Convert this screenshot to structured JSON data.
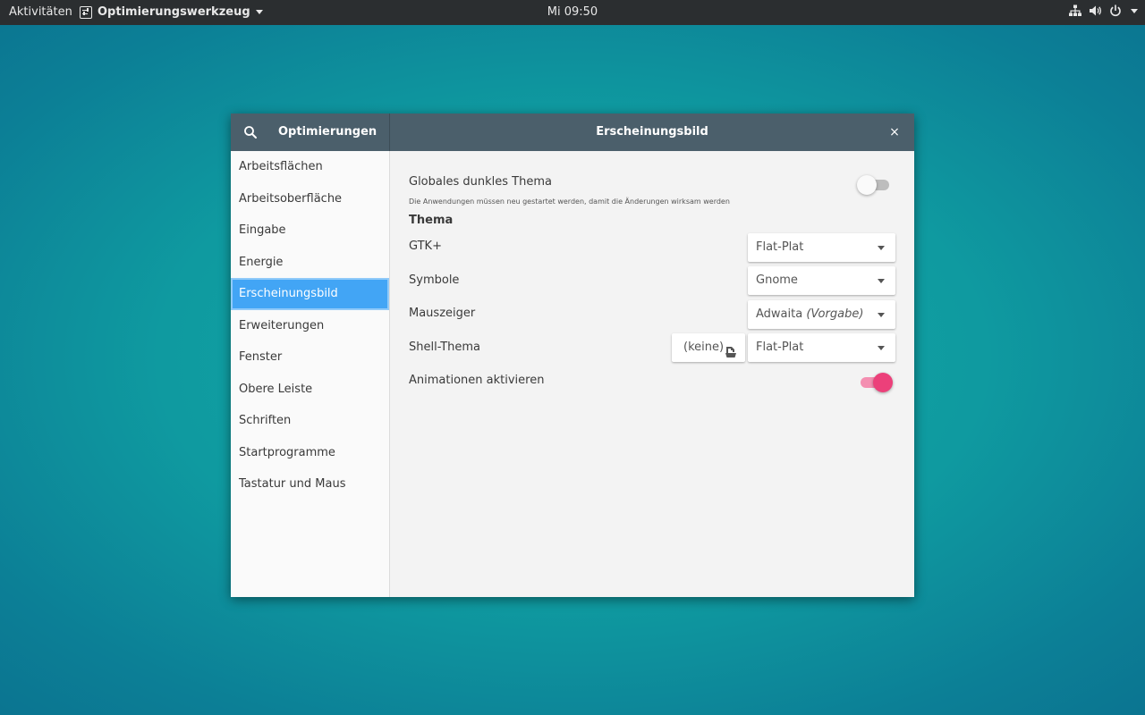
{
  "topbar": {
    "activities": "Aktivitäten",
    "app_name": "Optimierungswerkzeug",
    "clock": "Mi 09:50"
  },
  "window": {
    "sidebar_title": "Optimierungen",
    "title": "Erscheinungsbild",
    "close": "×"
  },
  "sidebar": {
    "items": [
      {
        "label": "Arbeitsflächen"
      },
      {
        "label": "Arbeitsoberfläche"
      },
      {
        "label": "Eingabe"
      },
      {
        "label": "Energie"
      },
      {
        "label": "Erscheinungsbild",
        "selected": true
      },
      {
        "label": "Erweiterungen"
      },
      {
        "label": "Fenster"
      },
      {
        "label": "Obere Leiste"
      },
      {
        "label": "Schriften"
      },
      {
        "label": "Startprogramme"
      },
      {
        "label": "Tastatur und Maus"
      }
    ]
  },
  "content": {
    "dark_theme": {
      "label": "Globales dunkles Thema",
      "hint": "Die Anwendungen müssen neu gestartet werden, damit die Änderungen wirksam werden",
      "enabled": false
    },
    "section_title": "Thema",
    "gtk": {
      "label": "GTK+",
      "value": "Flat-Plat"
    },
    "icons": {
      "label": "Symbole",
      "value": "Gnome"
    },
    "cursor": {
      "label": "Mauszeiger",
      "value": "Adwaita",
      "value_suffix": "(Vorgabe)"
    },
    "shell": {
      "label": "Shell-Thema",
      "file_button": "(keine)",
      "value": "Flat-Plat"
    },
    "animations": {
      "label": "Animationen aktivieren",
      "enabled": true
    }
  },
  "colors": {
    "headerbar": "#4b5f6b",
    "selection": "#42a5f5",
    "switch_on": "#ec407a"
  }
}
